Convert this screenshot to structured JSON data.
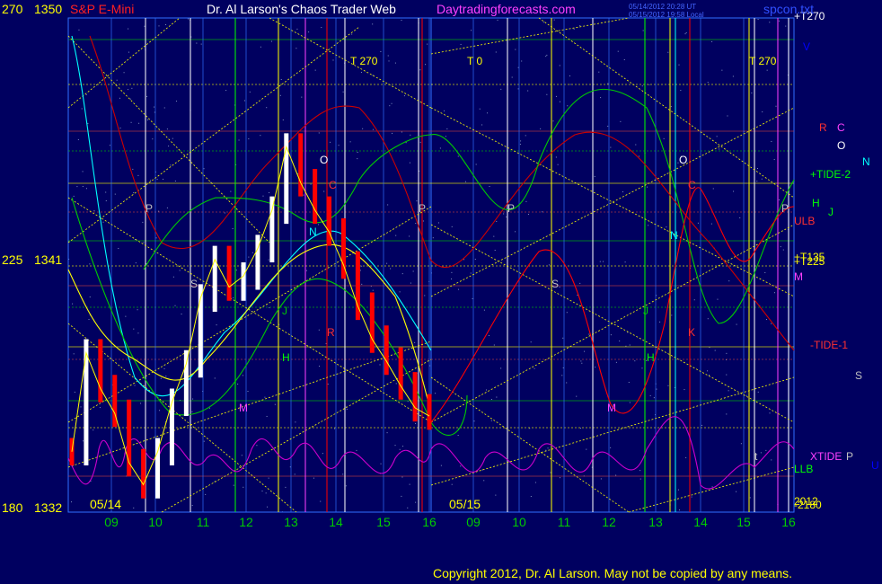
{
  "header": {
    "scale_top": "270",
    "price_top": "1350",
    "instrument": "S&P E-Mini",
    "title": "Dr. Al Larson's Chaos Trader Web",
    "site": "Daytradingforecasts.com",
    "stamp_line1": "05/14/2012 20:28 UT",
    "stamp_line2": "05/15/2012 19:58 Local",
    "right_label": "spcon.txt"
  },
  "footer": {
    "copyright": "Copyright 2012, Dr. Al Larson. May not be copied by any means."
  },
  "colors": {
    "background": "#000060",
    "grid": "#3070ff",
    "price_up": "#ffffff",
    "price_down": "#ff0000",
    "lines_yellow": "#ffff00",
    "lines_green": "#00cc00",
    "lines_red": "#cc0000",
    "lines_cyan": "#00ffff",
    "lines_magenta": "#cc00cc"
  },
  "chart_data": {
    "type": "line",
    "title": "S&P E-Mini",
    "y_axis": {
      "ticks": [
        {
          "scale": "270",
          "price": "1350",
          "value": 1350
        },
        {
          "scale": "225",
          "price": "1341",
          "value": 1341
        },
        {
          "scale": "180",
          "price": "1332",
          "value": 1332
        }
      ],
      "ylim": [
        1332,
        1350
      ]
    },
    "x_axis": {
      "days": [
        "05/14",
        "05/15"
      ],
      "hours": [
        "09",
        "10",
        "11",
        "12",
        "13",
        "14",
        "15",
        "16",
        "09",
        "10",
        "11",
        "12",
        "13",
        "14",
        "15",
        "16"
      ]
    },
    "t_labels": [
      "T 270",
      "T 0",
      "T 270"
    ],
    "right_labels": [
      {
        "text": "+T270",
        "color": "#ffffff"
      },
      {
        "text": "V",
        "color": "#0000ff"
      },
      {
        "text": "R",
        "color": "#ff3030"
      },
      {
        "text": "C",
        "color": "#ff40ff"
      },
      {
        "text": "O",
        "color": "#ffffff"
      },
      {
        "text": "N",
        "color": "#00ffff"
      },
      {
        "text": "+TIDE-2",
        "color": "#00ff00"
      },
      {
        "text": "H",
        "color": "#00ff00"
      },
      {
        "text": "J",
        "color": "#00ff00"
      },
      {
        "text": "ULB",
        "color": "#ff3030"
      },
      {
        "text": "+T135",
        "color": "#ffff00"
      },
      {
        "text": "+T225",
        "color": "#ffff00"
      },
      {
        "text": "M",
        "color": "#ff40ff"
      },
      {
        "text": "-TIDE-1",
        "color": "#ff3030"
      },
      {
        "text": "S",
        "color": "#c0c0c0"
      },
      {
        "text": "XTIDE",
        "color": "#ff40ff"
      },
      {
        "text": "P",
        "color": "#c0c0c0"
      },
      {
        "text": "U",
        "color": "#0000ff"
      },
      {
        "text": "LLB",
        "color": "#00ff00"
      },
      {
        "text": "2012",
        "color": "#ffff00"
      },
      {
        "text": "-2180",
        "color": "#ffff00"
      }
    ],
    "plot_labels_day1": [
      "P",
      "S",
      "M",
      "J",
      "H",
      "R",
      "O",
      "C",
      "N",
      "P"
    ],
    "plot_labels_day2": [
      "P",
      "S",
      "M",
      "J",
      "H",
      "O",
      "C",
      "N",
      "K",
      "P",
      "t"
    ],
    "series": [
      {
        "color": "#ff0000",
        "points": [
          [
            1334.2,
            1
          ],
          [
            1337.8,
            0
          ],
          [
            1336.5,
            1
          ],
          [
            1335.6,
            1
          ],
          [
            1333.8,
            1
          ],
          [
            1333.0,
            1
          ],
          [
            1334.2,
            0
          ],
          [
            1336.0,
            0
          ],
          [
            1337.4,
            0
          ],
          [
            1339.8,
            0
          ],
          [
            1341.2,
            0
          ],
          [
            1340.2,
            1
          ],
          [
            1340.6,
            0
          ],
          [
            1341.6,
            0
          ],
          [
            1343.0,
            0
          ],
          [
            1345.3,
            0
          ],
          [
            1344.0,
            1
          ],
          [
            1343.0,
            1
          ],
          [
            1342.2,
            1
          ],
          [
            1341.0,
            1
          ],
          [
            1339.5,
            1
          ],
          [
            1338.3,
            1
          ],
          [
            1337.5,
            1
          ],
          [
            1336.6,
            1
          ],
          [
            1335.8,
            1
          ],
          [
            1335.5,
            1
          ]
        ]
      }
    ]
  }
}
